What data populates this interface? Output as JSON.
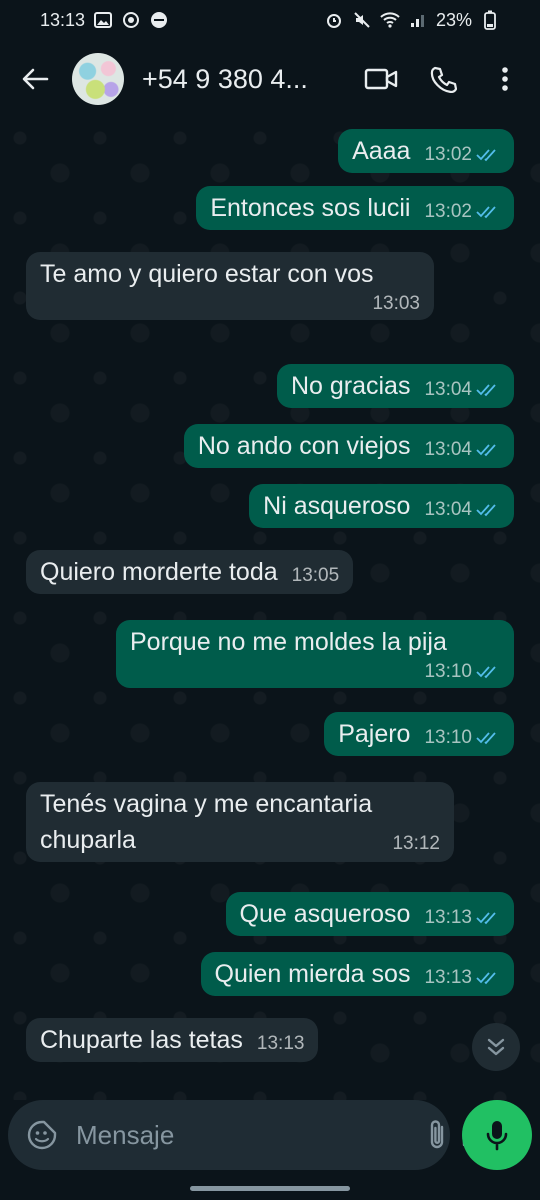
{
  "status_bar": {
    "time": "13:13",
    "battery": "23%"
  },
  "header": {
    "contact_name": "+54 9 380 4..."
  },
  "messages": [
    {
      "dir": "out",
      "text": "Aaaa",
      "time": "13:02"
    },
    {
      "dir": "out",
      "text": "Entonces sos lucii",
      "time": "13:02"
    },
    {
      "dir": "in",
      "text": "Te amo y quiero estar con vos",
      "time": "13:03"
    },
    {
      "dir": "out",
      "text": "No gracias",
      "time": "13:04"
    },
    {
      "dir": "out",
      "text": "No ando con viejos",
      "time": "13:04"
    },
    {
      "dir": "out",
      "text": "Ni asqueroso",
      "time": "13:04"
    },
    {
      "dir": "in",
      "text": "Quiero morderte toda",
      "time": "13:05"
    },
    {
      "dir": "out",
      "text": "Porque no me moldes la pija",
      "time": "13:10"
    },
    {
      "dir": "out",
      "text": "Pajero",
      "time": "13:10"
    },
    {
      "dir": "in",
      "text": "Tenés vagina y me encantaria chuparla",
      "time": "13:12"
    },
    {
      "dir": "out",
      "text": "Que asqueroso",
      "time": "13:13"
    },
    {
      "dir": "out",
      "text": "Quien mierda sos",
      "time": "13:13"
    },
    {
      "dir": "in",
      "text": "Chuparte las tetas",
      "time": "13:13"
    }
  ],
  "composer": {
    "placeholder": "Mensaje"
  },
  "colors": {
    "outgoing": "#005c4b",
    "incoming": "#202c33",
    "read_tick": "#53bdeb",
    "accent": "#21c063"
  }
}
